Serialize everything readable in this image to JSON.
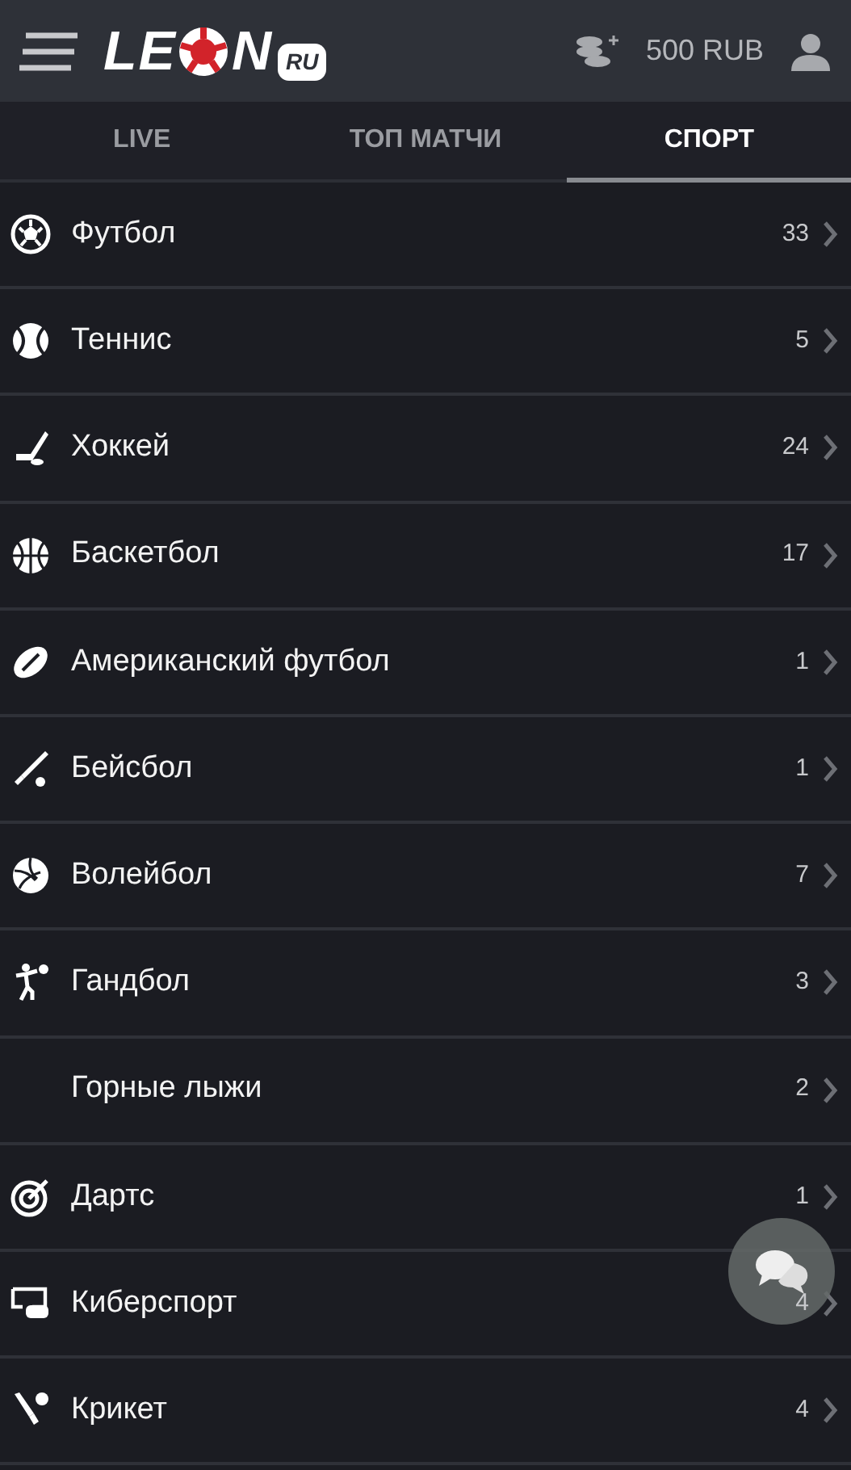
{
  "header": {
    "logo": {
      "before": "LE",
      "after": "N",
      "badge": "RU"
    },
    "balance": "500 RUB"
  },
  "tabs": [
    {
      "label": "LIVE",
      "selected": false
    },
    {
      "label": "ТОП МАТЧИ",
      "selected": false
    },
    {
      "label": "СПОРТ",
      "selected": true
    }
  ],
  "sports": [
    {
      "name": "Футбол",
      "count": "33",
      "has_icon": true
    },
    {
      "name": "Теннис",
      "count": "5",
      "has_icon": true
    },
    {
      "name": "Хоккей",
      "count": "24",
      "has_icon": true
    },
    {
      "name": "Баскетбол",
      "count": "17",
      "has_icon": true
    },
    {
      "name": "Американский футбол",
      "count": "1",
      "has_icon": true
    },
    {
      "name": "Бейсбол",
      "count": "1",
      "has_icon": true
    },
    {
      "name": "Волейбол",
      "count": "7",
      "has_icon": true
    },
    {
      "name": "Гандбол",
      "count": "3",
      "has_icon": true
    },
    {
      "name": "Горные лыжи",
      "count": "2",
      "has_icon": false
    },
    {
      "name": "Дартс",
      "count": "1",
      "has_icon": true
    },
    {
      "name": "Киберспорт",
      "count": "4",
      "has_icon": true
    },
    {
      "name": "Крикет",
      "count": "4",
      "has_icon": true
    }
  ]
}
